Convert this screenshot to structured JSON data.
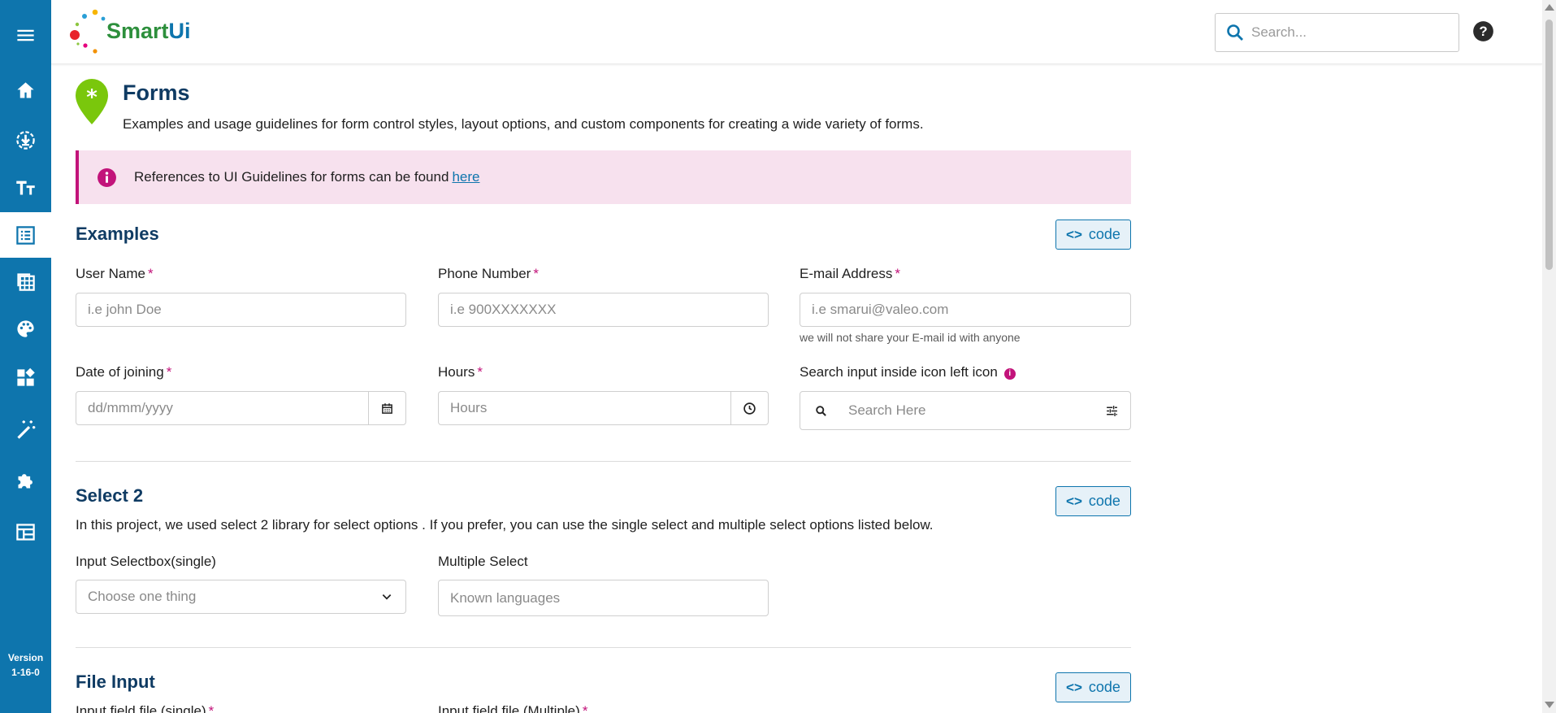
{
  "sidebar": {
    "items": [
      {
        "icon": "menu-icon"
      },
      {
        "icon": "home-icon"
      },
      {
        "icon": "download-icon"
      },
      {
        "icon": "typography-icon"
      },
      {
        "icon": "forms-icon",
        "active": true
      },
      {
        "icon": "tables-icon"
      },
      {
        "icon": "palette-icon"
      },
      {
        "icon": "widgets-icon"
      },
      {
        "icon": "magic-wand-icon"
      },
      {
        "icon": "puzzle-icon"
      },
      {
        "icon": "layout-icon"
      }
    ],
    "version_label": "Version",
    "version_value": "1-16-0"
  },
  "header": {
    "logo_smart": "Smart",
    "logo_ui": "Ui",
    "search_placeholder": "Search...",
    "help_icon": "help-icon"
  },
  "page": {
    "title": "Forms",
    "description": "Examples and usage guidelines for form control styles, layout options, and custom components for creating a wide variety of forms.",
    "alert_text": "References to UI Guidelines for forms can be found",
    "alert_link": "here"
  },
  "examples": {
    "title": "Examples",
    "code_label": "code",
    "user_name": {
      "label": "User Name",
      "required": "*",
      "placeholder": "i.e john Doe"
    },
    "phone": {
      "label": "Phone Number",
      "required": "*",
      "placeholder": "i.e 900XXXXXXX"
    },
    "email": {
      "label": "E-mail Address",
      "required": "*",
      "placeholder": "i.e smarui@valeo.com",
      "help": "we will not share your E-mail id with anyone"
    },
    "date": {
      "label": "Date of joining",
      "required": "*",
      "placeholder": "dd/mmm/yyyy"
    },
    "hours": {
      "label": "Hours",
      "required": "*",
      "placeholder": "Hours"
    },
    "search_icon_field": {
      "label": "Search input inside icon left icon",
      "placeholder": "Search Here"
    }
  },
  "select2": {
    "title": "Select 2",
    "code_label": "code",
    "description": "In this project, we used select 2 library for select options . If you prefer, you can use the single select and multiple select options listed below.",
    "single": {
      "label": "Input Selectbox(single)",
      "placeholder": "Choose one thing"
    },
    "multiple": {
      "label": "Multiple Select",
      "placeholder": "Known languages"
    }
  },
  "file_input": {
    "title": "File Input",
    "code_label": "code",
    "single_label": "Input field file (single)",
    "multiple_label": "Input field file (Multiple)",
    "required": "*"
  },
  "colors": {
    "sidebar": "#0e75ad",
    "title": "#0f3b63",
    "accent": "#c2137a",
    "alert_bg": "#f7e1ee",
    "leaf": "#7ac70c"
  }
}
